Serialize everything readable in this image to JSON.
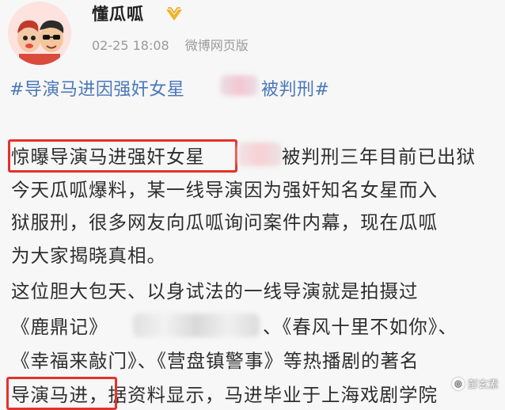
{
  "post": {
    "author": "懂瓜呱",
    "timestamp": "02-25 18:08",
    "source": "微博网页版",
    "badge_icon": "gold-v-badge-icon"
  },
  "topic": {
    "prefix": "#导演马进因强奸女星",
    "suffix": "被判刑#",
    "color": "#4a78b8"
  },
  "body": {
    "line1_highlight": "惊曝导演马进强奸女星",
    "line1_rest": "被判刑三年目前已出狱",
    "line2": "今天瓜呱爆料，某一线导演因为强奸知名女星而入",
    "line3": "狱服刑，很多网友向瓜呱询问案件内幕，现在瓜呱",
    "line4": "为大家揭晓真相。",
    "line5": "这位胆大包天、以身试法的一线导演就是拍摄过",
    "line6_a": "《鹿鼎记》",
    "line6_b": "、《春风十里不如你》、",
    "line7": "《幸福来敲门》、《营盘镇警事》等热播剧的著名",
    "line8_highlight": "导演马进",
    "line8_rest": "，据资料显示，马进毕业于上海戏剧学院"
  },
  "watermark": {
    "text": "彭玄素"
  },
  "colors": {
    "highlight_box": "#e4322b",
    "background": "#f7f7f7"
  }
}
